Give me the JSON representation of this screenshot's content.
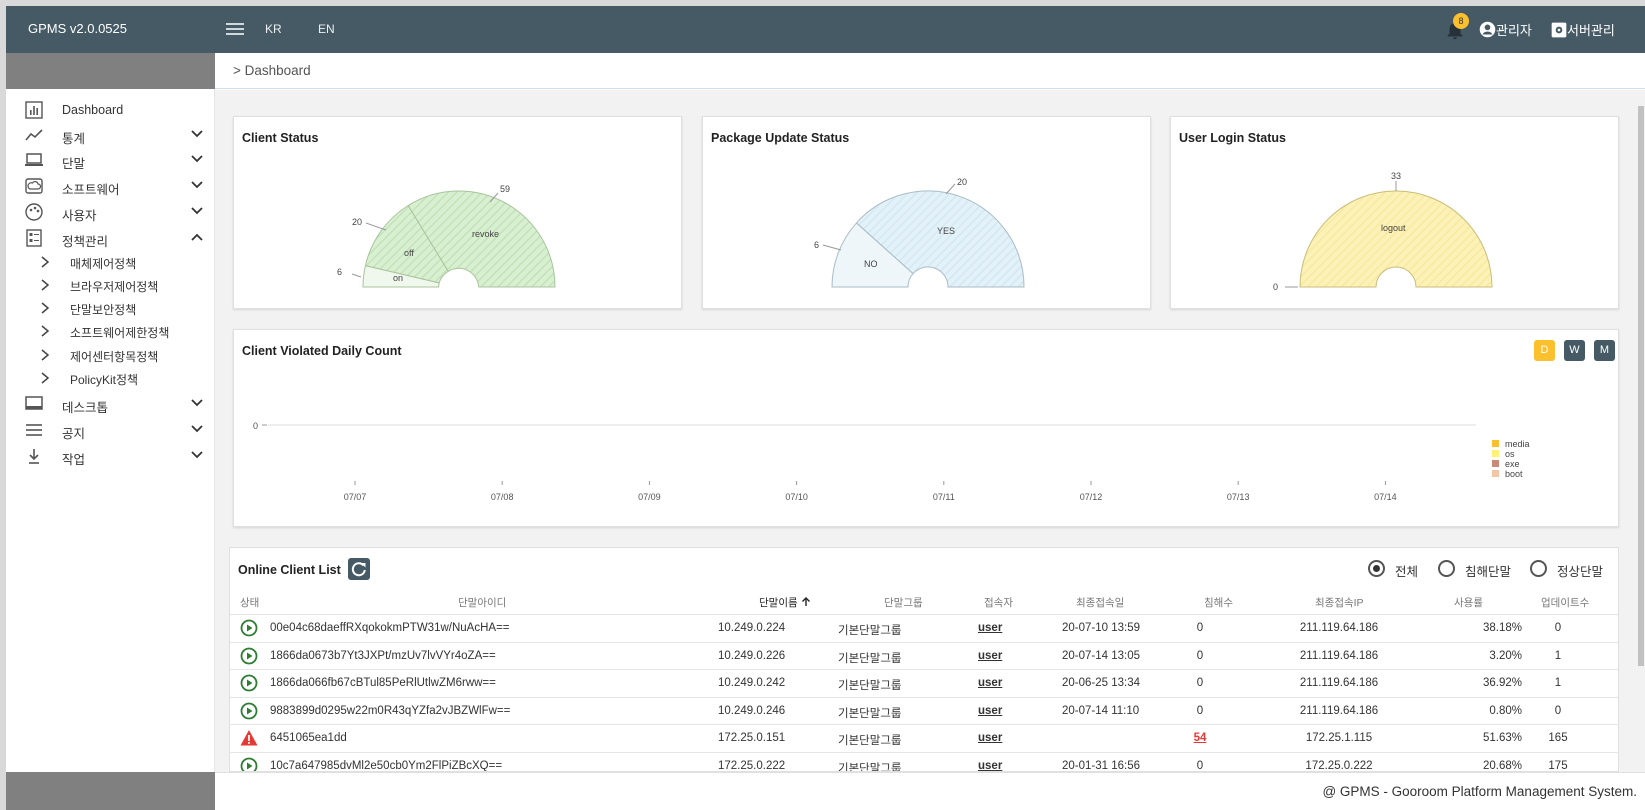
{
  "app": {
    "version": "GPMS v2.0.0525",
    "lang_kr": "KR",
    "lang_en": "EN",
    "notification_count": "8",
    "admin_label": "관리자",
    "server_label": "서버관리"
  },
  "breadcrumb": "> Dashboard",
  "sidebar": {
    "items": [
      {
        "label": "Dashboard",
        "icon": "bar-chart-icon"
      },
      {
        "label": "통계",
        "icon": "trend-icon"
      },
      {
        "label": "단말",
        "icon": "laptop-icon"
      },
      {
        "label": "소프트웨어",
        "icon": "cloud-icon"
      },
      {
        "label": "사용자",
        "icon": "palette-icon"
      },
      {
        "label": "정책관리",
        "icon": "policy-icon"
      },
      {
        "label": "데스크톱",
        "icon": "desktop-icon"
      },
      {
        "label": "공지",
        "icon": "list-icon"
      },
      {
        "label": "작업",
        "icon": "download-icon"
      }
    ],
    "policy_sub": [
      "매체제어정책",
      "브라우저제어정책",
      "단말보안정책",
      "소프트웨어제한정책",
      "제어센터항목정책",
      "PolicyKit정책"
    ]
  },
  "cards": {
    "client_status": {
      "title": "Client Status",
      "on_label": "on",
      "off_label": "off",
      "revoke_label": "revoke",
      "on_value": "6",
      "off_value": "20",
      "revoke_value": "59"
    },
    "package_status": {
      "title": "Package Update Status",
      "no_label": "NO",
      "yes_label": "YES",
      "no_value": "6",
      "yes_value": "20"
    },
    "login_status": {
      "title": "User Login Status",
      "logout_label": "logout",
      "logout_value": "33",
      "login_value": "0"
    }
  },
  "chart_data": {
    "type": "bar",
    "title": "Client Violated Daily Count",
    "categories": [
      "07/07",
      "07/08",
      "07/09",
      "07/10",
      "07/11",
      "07/12",
      "07/13",
      "07/14"
    ],
    "series": [
      {
        "name": "media",
        "values": [
          0,
          0,
          0,
          0,
          0,
          0,
          0,
          0
        ]
      },
      {
        "name": "os",
        "values": [
          0,
          0,
          0,
          0,
          0,
          0,
          0,
          0
        ]
      },
      {
        "name": "exe",
        "values": [
          0,
          0,
          0,
          0,
          0,
          0,
          0,
          0
        ]
      },
      {
        "name": "boot",
        "values": [
          0,
          0,
          0,
          0,
          0,
          0,
          0,
          0
        ]
      }
    ],
    "y_tick": "0",
    "legend": "right",
    "colors": {
      "media": "#fbc02d",
      "os": "#fff176",
      "exe": "#c98a7a",
      "boot": "#f3c6a8"
    }
  },
  "period_buttons": [
    "D",
    "W",
    "M"
  ],
  "client_list": {
    "title": "Online Client List",
    "filters": [
      {
        "label": "전체",
        "checked": true
      },
      {
        "label": "침해단말",
        "checked": false
      },
      {
        "label": "정상단말",
        "checked": false
      }
    ],
    "columns": [
      "상태",
      "단말아이디",
      "단말이름",
      "단말그룹",
      "접속자",
      "최종접속일",
      "침해수",
      "최종접속IP",
      "사용률",
      "업데이트수"
    ],
    "rows": [
      {
        "status": "ok",
        "id": "00e04c68daeffRXqokokmPTW31w/NuAcHA==",
        "name": "10.249.0.224",
        "group": "기본단말그룹",
        "user": "user",
        "date": "20-07-10 13:59",
        "violations": "0",
        "ip": "211.119.64.186",
        "usage": "38.18%",
        "updates": "0"
      },
      {
        "status": "ok",
        "id": "1866da0673b7Yt3JXPt/mzUv7lvVYr4oZA==",
        "name": "10.249.0.226",
        "group": "기본단말그룹",
        "user": "user",
        "date": "20-07-14 13:05",
        "violations": "0",
        "ip": "211.119.64.186",
        "usage": "3.20%",
        "updates": "1"
      },
      {
        "status": "ok",
        "id": "1866da066fb67cBTul85PeRlUtlwZM6rww==",
        "name": "10.249.0.242",
        "group": "기본단말그룹",
        "user": "user",
        "date": "20-06-25 13:34",
        "violations": "0",
        "ip": "211.119.64.186",
        "usage": "36.92%",
        "updates": "1"
      },
      {
        "status": "ok",
        "id": "9883899d0295w22m0R43qYZfa2vJBZWlFw==",
        "name": "10.249.0.246",
        "group": "기본단말그룹",
        "user": "user",
        "date": "20-07-14 11:10",
        "violations": "0",
        "ip": "211.119.64.186",
        "usage": "0.80%",
        "updates": "0"
      },
      {
        "status": "warn",
        "id": "6451065ea1dd",
        "name": "172.25.0.151",
        "group": "기본단말그룹",
        "user": "user",
        "date": "",
        "violations": "54",
        "ip": "172.25.1.115",
        "usage": "51.63%",
        "updates": "165"
      },
      {
        "status": "ok",
        "id": "10c7a647985dvMl2e50cb0Ym2FlPiZBcXQ==",
        "name": "172.25.0.222",
        "group": "기본단말그룹",
        "user": "user",
        "date": "20-01-31 16:56",
        "violations": "0",
        "ip": "172.25.0.222",
        "usage": "20.68%",
        "updates": "175"
      }
    ]
  },
  "footer": "@ GPMS - Gooroom Platform Management System."
}
